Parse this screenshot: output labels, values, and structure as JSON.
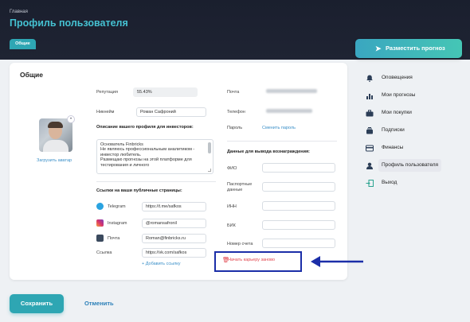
{
  "header": {
    "breadcrumb": "Главная",
    "title": "Профиль пользователя",
    "tab": "Общие"
  },
  "card": {
    "title": "Общие",
    "upload_avatar": "Загрузить аватар",
    "reputation_label": "Репутация",
    "reputation_value": "55.43%",
    "nickname_label": "Никнейм",
    "nickname_value": "Роман Сафроний",
    "description_label": "Описание вашего профиля для инвесторов:",
    "description_value": "Основатель Finbricks\nНе являюсь профессиональным аналитиком - инвестор любитель.\nРазмещаю прогнозы на этой платформе для тестирования и личного",
    "links_label": "Ссылки на ваши публичные страницы:",
    "links": [
      {
        "label": "Telegram",
        "value": "https://t.me/safkos",
        "icon": "telegram-icon",
        "color": "#2aa3e0"
      },
      {
        "label": "Instagram",
        "value": "@romansafronil",
        "icon": "instagram-icon",
        "color": "#d6336c"
      },
      {
        "label": "Почта",
        "value": "Roman@finbricks.ru",
        "icon": "mail-icon",
        "color": "#3b4a5e"
      },
      {
        "label": "Ссылка",
        "value": "https://vk.com/safkos",
        "icon": "",
        "color": ""
      }
    ],
    "add_link": "+ Добавить ссылку",
    "email_label": "Почта",
    "phone_label": "Телефон",
    "password_label": "Пароль",
    "change_password": "Сменить пароль",
    "payout_label": "Данные для вывода вознаграждения:",
    "payout_fields": [
      "ФИО",
      "Паспортные данные",
      "ИНН",
      "БИК",
      "Номер счета"
    ],
    "reset_career": "Начать карьеру заново"
  },
  "actions": {
    "save": "Сохранить",
    "cancel": "Отменить"
  },
  "sidebar": {
    "post_button": "Разместить прогноз",
    "items": [
      {
        "label": "Оповещения",
        "icon": "bell-icon"
      },
      {
        "label": "Мои прогнозы",
        "icon": "chart-icon"
      },
      {
        "label": "Мои покупки",
        "icon": "briefcase-icon"
      },
      {
        "label": "Подписки",
        "icon": "subscriptions-icon"
      },
      {
        "label": "Финансы",
        "icon": "finance-icon"
      },
      {
        "label": "Профиль пользователя",
        "icon": "user-icon",
        "active": true
      },
      {
        "label": "Выход",
        "icon": "logout-icon"
      }
    ]
  },
  "colors": {
    "accent": "#2ea6b3",
    "header_bg": "#1a1f2e",
    "danger": "#e0424b",
    "annotation": "#1b2ea8"
  }
}
